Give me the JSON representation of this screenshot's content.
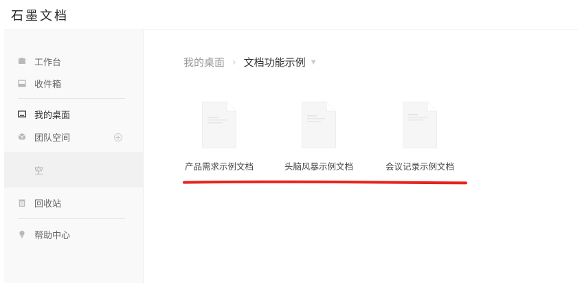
{
  "app": {
    "title": "石墨文档"
  },
  "sidebar": {
    "items": [
      {
        "label": "工作台",
        "icon": "workbench-icon"
      },
      {
        "label": "收件箱",
        "icon": "inbox-icon"
      },
      {
        "label": "我的桌面",
        "icon": "desktop-icon"
      },
      {
        "label": "团队空间",
        "icon": "team-space-icon"
      },
      {
        "label": "回收站",
        "icon": "trash-icon"
      },
      {
        "label": "帮助中心",
        "icon": "help-center-icon"
      }
    ],
    "team_empty_label": "空",
    "add_icon": "plus-circle-icon"
  },
  "breadcrumb": {
    "root": "我的桌面",
    "separator": "›",
    "current": "文档功能示例",
    "caret": "▼"
  },
  "documents": [
    {
      "name": "产品需求示例文档",
      "icon": "document-icon"
    },
    {
      "name": "头脑风暴示例文档",
      "icon": "document-icon"
    },
    {
      "name": "会议记录示例文档",
      "icon": "document-icon"
    }
  ],
  "colors": {
    "accent_underline": "#e8221c",
    "sidebar_bg": "#f9f9f9",
    "empty_slot_bg": "#f1f1f1",
    "icon_gray": "#b9b9b9"
  }
}
